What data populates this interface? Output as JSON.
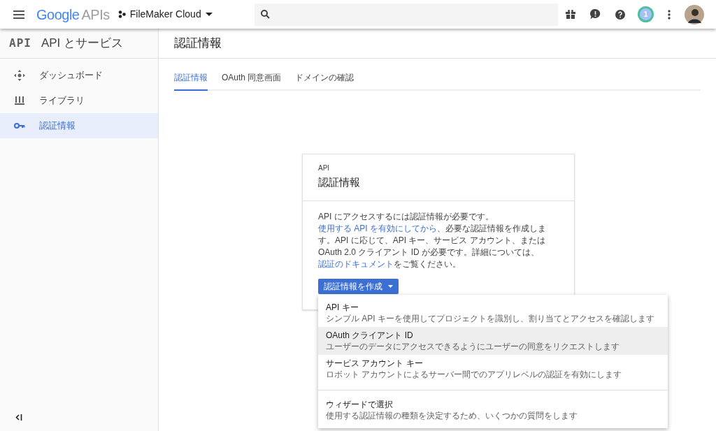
{
  "header": {
    "logo_brand": "Google",
    "logo_product": "APIs",
    "project": "FileMaker Cloud",
    "notification_count": "1"
  },
  "sidebar": {
    "badge": "API",
    "title": "API とサービス",
    "items": [
      {
        "label": "ダッシュボード",
        "kind": "dashboard",
        "selected": false
      },
      {
        "label": "ライブラリ",
        "kind": "library",
        "selected": false
      },
      {
        "label": "認証情報",
        "kind": "key",
        "selected": true
      }
    ]
  },
  "page_title": "認証情報",
  "tabs": [
    {
      "label": "認証情報",
      "selected": true
    },
    {
      "label": "OAuth 同意画面",
      "selected": false
    },
    {
      "label": "ドメインの確認",
      "selected": false
    }
  ],
  "card": {
    "overline": "API",
    "title": "認証情報",
    "description": [
      {
        "text": "API にアクセスするには認証情報が必要です。",
        "link": false
      },
      {
        "text": "使用する API を有効にしてから",
        "link": true
      },
      {
        "text": "、必要な認証情報を作成します。API に応じて、API キー、サービス アカウント、または OAuth 2.0 クライアント ID が必要です。詳細については、",
        "link": false
      },
      {
        "text": "認証のドキュメント",
        "link": true
      },
      {
        "text": "をご覧ください。",
        "link": false
      }
    ],
    "button": "認証情報を作成"
  },
  "menu": [
    {
      "title": "API キー",
      "description": "シンプル API キーを使用してプロジェクトを識別し、割り当てとアクセスを確認します",
      "selected": false,
      "divider_before": false
    },
    {
      "title": "OAuth クライアント ID",
      "description": "ユーザーのデータにアクセスできるようにユーザーの同意をリクエストします",
      "selected": true,
      "divider_before": false
    },
    {
      "title": "サービス アカウント キー",
      "description": "ロボット アカウントによるサーバー間でのアプリレベルの認証を有効にします",
      "selected": false,
      "divider_before": false
    },
    {
      "title": "ウィザードで選択",
      "description": "使用する認証情報の種類を決定するため、いくつかの質問をします",
      "selected": false,
      "divider_before": true
    }
  ]
}
